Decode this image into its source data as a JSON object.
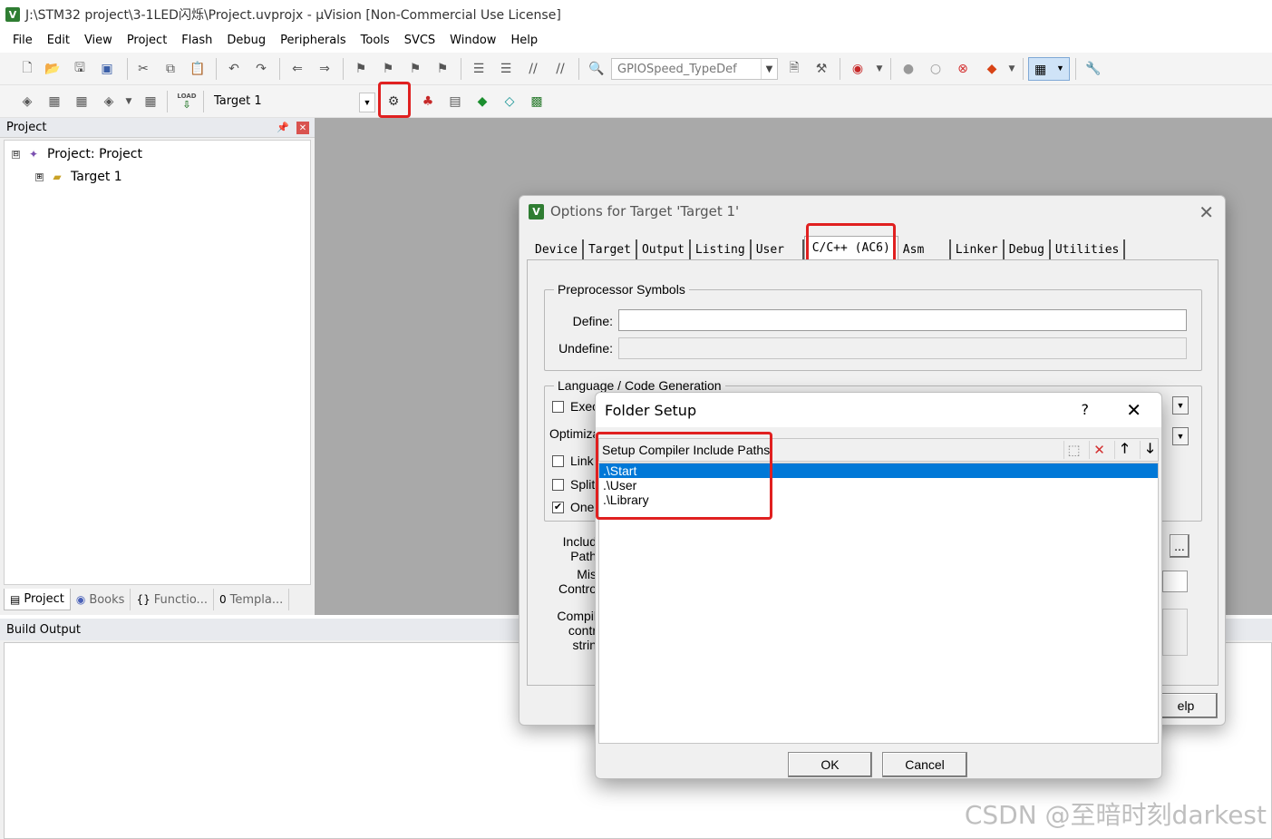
{
  "window": {
    "app_icon": "V",
    "title": "J:\\STM32 project\\3-1LED闪烁\\Project.uvprojx - µVision  [Non-Commercial Use License]"
  },
  "menu": [
    "File",
    "Edit",
    "View",
    "Project",
    "Flash",
    "Debug",
    "Peripherals",
    "Tools",
    "SVCS",
    "Window",
    "Help"
  ],
  "toolbar1": {
    "find_combo_value": "GPIOSpeed_TypeDef"
  },
  "toolbar2": {
    "target_combo_value": "Target 1",
    "load_label": "LOAD"
  },
  "project_panel": {
    "header": "Project",
    "pin_icon": "pin-icon",
    "tree": [
      {
        "label": "Project: Project",
        "expander": "⊟"
      },
      {
        "label": "Target 1",
        "expander": "⊞"
      }
    ],
    "tabs": [
      {
        "label": "Project",
        "icon": "▤"
      },
      {
        "label": "Books",
        "icon": "◉"
      },
      {
        "label": "Functio...",
        "icon": "{}"
      },
      {
        "label": "Templa...",
        "icon": "0"
      }
    ]
  },
  "build_output": {
    "header": "Build Output"
  },
  "options_dialog": {
    "title": "Options for Target 'Target 1'",
    "tabs": [
      "Device",
      "Target",
      "Output",
      "Listing",
      "User",
      "C/C++ (AC6)",
      "Asm",
      "Linker",
      "Debug",
      "Utilities"
    ],
    "active_tab": "C/C++ (AC6)",
    "preprocessor": {
      "legend": "Preprocessor Symbols",
      "define_label": "Define:",
      "define_value": "",
      "undefine_label": "Undefine:",
      "undefine_value": ""
    },
    "language": {
      "legend": "Language / Code Generation",
      "checks": [
        {
          "label": "Exec",
          "checked": false
        },
        {
          "label": "Link",
          "checked": false
        },
        {
          "label": "Split",
          "checked": false
        },
        {
          "label": "One",
          "checked": true
        }
      ],
      "optimize_label": "Optimiza"
    },
    "include_label_1": "Includ",
    "include_label_2": "Path",
    "misc_label_1": "Mis",
    "misc_label_2": "Contro",
    "compiler_label_1": "Compil",
    "compiler_label_2": "contr",
    "compiler_label_3": "strin",
    "browse_button": "...",
    "help_button_fragment": "elp"
  },
  "folder_setup": {
    "title": "Folder Setup",
    "help": "?",
    "close": "✕",
    "list_header": "Setup Compiler Include Paths:",
    "tool_icons": [
      "new-folder-icon",
      "delete-icon",
      "move-up-icon",
      "move-down-icon"
    ],
    "paths": [
      ".\\Start",
      ".\\User",
      ".\\Library"
    ],
    "selected_index": 0,
    "ok_label": "OK",
    "cancel_label": "Cancel"
  },
  "watermark": "CSDN @至暗时刻darkest",
  "colors": {
    "highlight_box": "#e02020",
    "selection": "#0078d7",
    "workspace": "#a9a9a9"
  }
}
